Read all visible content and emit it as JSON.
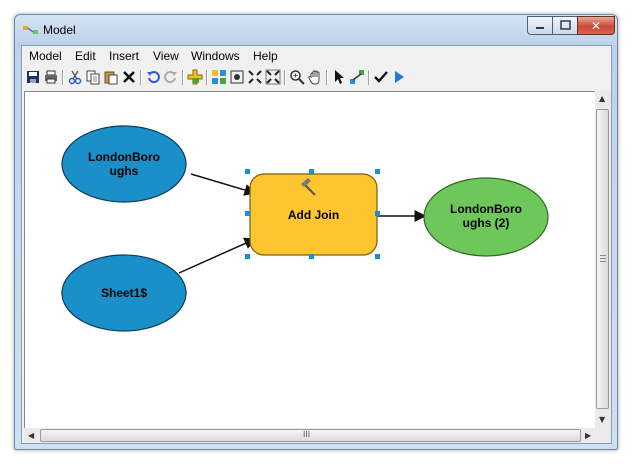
{
  "window": {
    "title": "Model"
  },
  "menu": [
    "Model",
    "Edit",
    "Insert",
    "View",
    "Windows",
    "Help"
  ],
  "toolbar": [
    "save-icon",
    "print-icon",
    "cut-icon",
    "copy-icon",
    "paste-icon",
    "delete-icon",
    "undo-icon",
    "redo-icon",
    "add-data-icon",
    "auto-layout-icon",
    "full-extent-icon",
    "zoom-in-fixed-icon",
    "zoom-out-fixed-icon",
    "zoom-icon",
    "pan-icon",
    "select-icon",
    "connect-icon",
    "validate-icon",
    "run-icon"
  ],
  "nodes": {
    "input1": {
      "line1": "LondonBoro",
      "line2": "ughs",
      "color": "#1a8fc8"
    },
    "input2": {
      "line1": "Sheet1$",
      "color": "#1a8fc8"
    },
    "tool": {
      "label": "Add Join",
      "color": "#fdc52f"
    },
    "output": {
      "line1": "LondonBoro",
      "line2": "ughs (2)",
      "color": "#6ec75b"
    }
  },
  "scroll": {
    "grip_text": "III"
  }
}
